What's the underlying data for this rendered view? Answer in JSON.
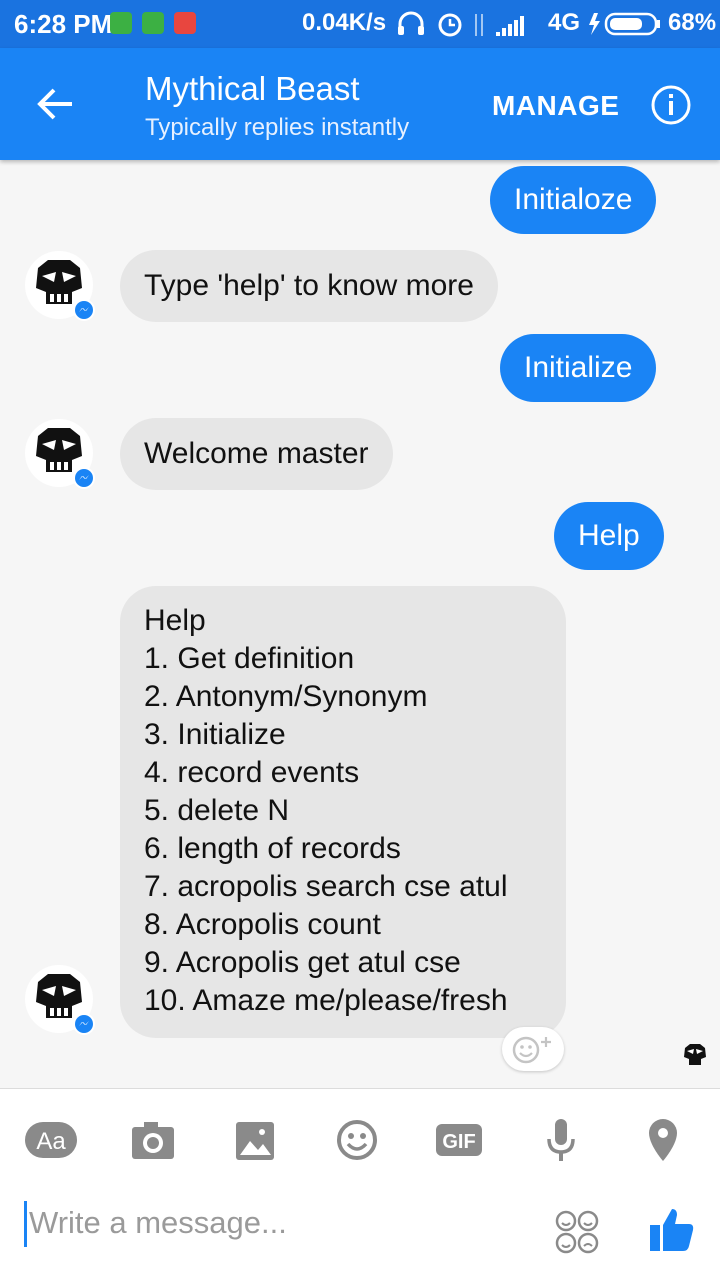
{
  "status_bar": {
    "time": "6:28 PM",
    "speed": "0.04K/s",
    "network": "4G",
    "battery": "68%",
    "icons": [
      "headphones-icon",
      "alarm-icon",
      "data-arrows-icon",
      "signal-icon",
      "charging-icon",
      "battery-icon"
    ]
  },
  "header": {
    "title": "Mythical Beast",
    "subtitle": "Typically replies instantly",
    "manage_label": "MANAGE",
    "back_icon": "back-arrow-icon",
    "info_icon": "info-icon"
  },
  "messages": [
    {
      "from": "me",
      "text": "Initialoze"
    },
    {
      "from": "bot",
      "text": "Type 'help' to know more"
    },
    {
      "from": "me",
      "text": "Initialize"
    },
    {
      "from": "bot",
      "text": "Welcome master"
    },
    {
      "from": "me",
      "text": "Help"
    },
    {
      "from": "bot",
      "lines": [
        "Help",
        "1. Get definition",
        "2. Antonym/Synonym",
        "3. Initialize",
        "4. record events",
        "5. delete N",
        "6. length of records",
        "7. acropolis search cse atul",
        "8. Acropolis count",
        "9. Acropolis get atul cse",
        "10. Amaze me/please/fresh"
      ]
    }
  ],
  "composer": {
    "aa_label": "Aa",
    "gif_label": "GIF",
    "placeholder": "Write a message...",
    "tools": [
      "text-format-icon",
      "camera-icon",
      "image-icon",
      "emoji-icon",
      "gif-icon",
      "microphone-icon",
      "location-icon"
    ]
  },
  "colors": {
    "accent": "#1a84f5",
    "status_bar": "#1a73e0",
    "bubble_in": "#e6e6e6",
    "tool_gray": "#8a8a8a"
  }
}
